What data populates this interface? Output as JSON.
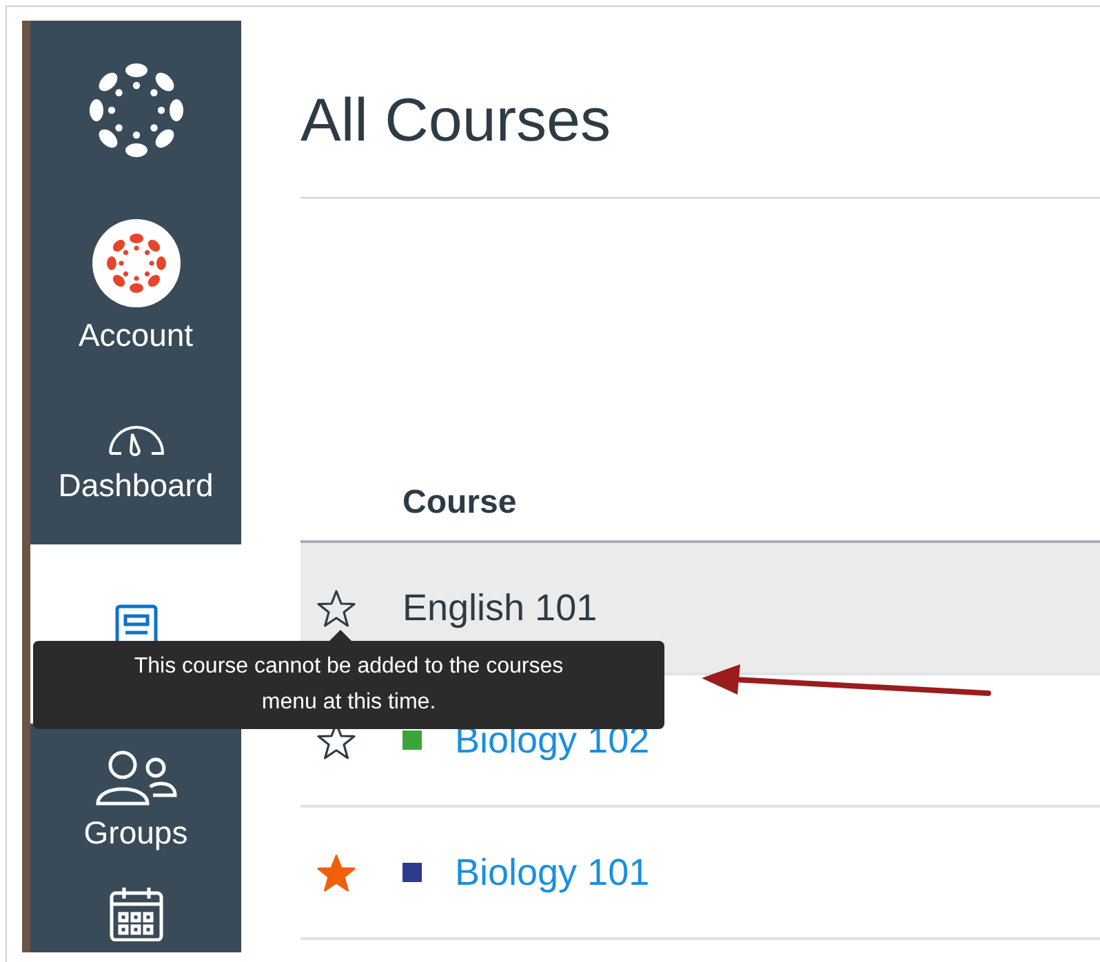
{
  "sidebar": {
    "items": [
      {
        "kind": "logo",
        "selected": false
      },
      {
        "kind": "account",
        "label": "Account",
        "selected": false
      },
      {
        "kind": "dashboard",
        "label": "Dashboard",
        "selected": false
      },
      {
        "kind": "courses",
        "selected": true
      },
      {
        "kind": "groups",
        "label": "Groups",
        "selected": false
      },
      {
        "kind": "calendar",
        "selected": false
      }
    ]
  },
  "page": {
    "title": "All Courses"
  },
  "table": {
    "columns": [
      "Course"
    ],
    "rows": [
      {
        "name": "English 101",
        "favorite": false,
        "link": false,
        "selected": true
      },
      {
        "name": "Biology 102",
        "favorite": false,
        "link": true,
        "color": "#3aa63a",
        "selected": false
      },
      {
        "name": "Biology 101",
        "favorite": true,
        "link": true,
        "color": "#2d3b8f",
        "selected": false
      }
    ]
  },
  "tooltip": {
    "text": "This course cannot be added to the courses menu at this time."
  }
}
